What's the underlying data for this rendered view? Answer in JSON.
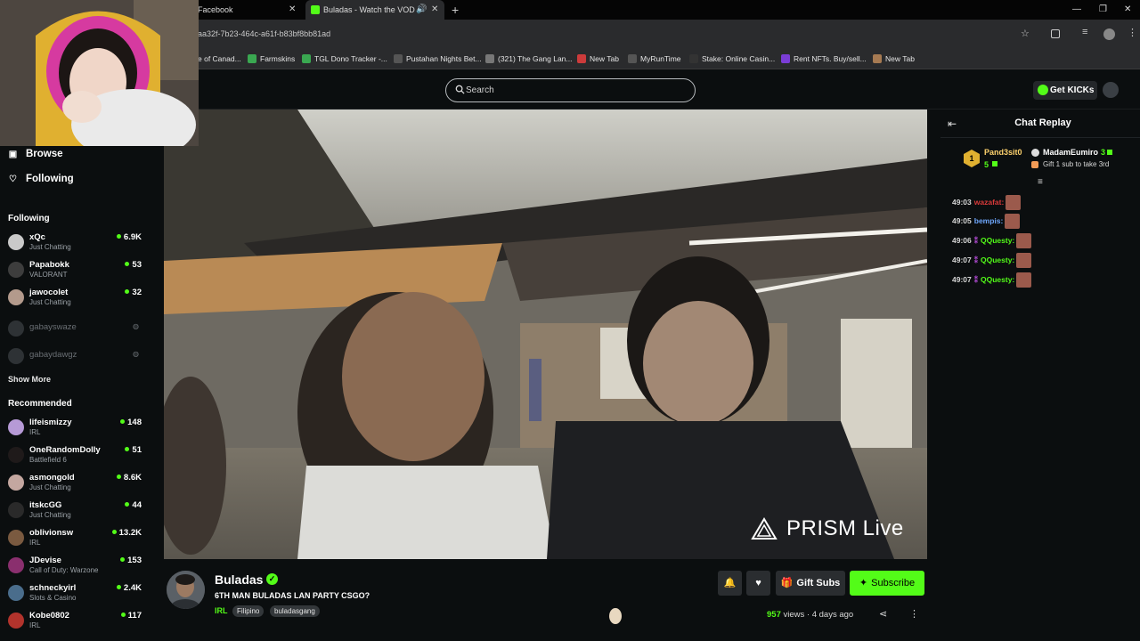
{
  "browser": {
    "tabs": [
      {
        "label": "Facebook",
        "active": false
      },
      {
        "label": "Buladas - Watch the VOD o",
        "active": true
      }
    ],
    "new_tab": "+",
    "url": "aa32f-7b23-464c-a61f-b83bf8bb81ad",
    "bookmarks": [
      "e of Canad...",
      "Farmskins",
      "TGL Dono Tracker -...",
      "Pustahan Nights Bet...",
      "(321) The Gang Lan...",
      "New Tab",
      "MyRunTime",
      "Stake: Online Casin...",
      "Rent NFTs. Buy/sell...",
      "New Tab"
    ]
  },
  "header": {
    "search_placeholder": "Search",
    "get_kicks": "Get KICKs"
  },
  "sidebar": {
    "nav": [
      {
        "label": "Browse",
        "icon": "browse-icon"
      },
      {
        "label": "Following",
        "icon": "heart-icon"
      }
    ],
    "following_title": "Following",
    "following": [
      {
        "name": "xQc",
        "category": "Just Chatting",
        "viewers": "6.9K",
        "avatar_color": "#c9c9c9"
      },
      {
        "name": "Papabokk",
        "category": "VALORANT",
        "viewers": "53",
        "avatar_color": "#3d3d3d"
      },
      {
        "name": "jawocolet",
        "category": "Just Chatting",
        "viewers": "32",
        "avatar_color": "#b39a8c"
      },
      {
        "name": "gabayswaze",
        "category": "",
        "viewers": "",
        "offline": true
      },
      {
        "name": "gabaydawgz",
        "category": "",
        "viewers": "",
        "offline": true
      }
    ],
    "show_more": "Show More",
    "recommended_title": "Recommended",
    "recommended": [
      {
        "name": "lifeismizzy",
        "category": "IRL",
        "viewers": "148",
        "avatar_color": "#b69ad6"
      },
      {
        "name": "OneRandomDolly",
        "category": "Battlefield 6",
        "viewers": "51",
        "avatar_color": "#1f1a1a"
      },
      {
        "name": "asmongold",
        "category": "Just Chatting",
        "viewers": "8.6K",
        "avatar_color": "#c4a7a0"
      },
      {
        "name": "itskcGG",
        "category": "Just Chatting",
        "viewers": "44",
        "avatar_color": "#2a2a2a"
      },
      {
        "name": "oblivionsw",
        "category": "IRL",
        "viewers": "13.2K",
        "avatar_color": "#7a5a40"
      },
      {
        "name": "JDevise",
        "category": "Call of Duty: Warzone",
        "viewers": "153",
        "avatar_color": "#8a2f6e"
      },
      {
        "name": "schneckyirl",
        "category": "Slots & Casino",
        "viewers": "2.4K",
        "avatar_color": "#4a6d8c"
      },
      {
        "name": "Kobe0802",
        "category": "IRL",
        "viewers": "117",
        "avatar_color": "#b2332c"
      }
    ]
  },
  "video": {
    "watermark": "PRISM Live"
  },
  "chat": {
    "title": "Chat Replay",
    "gift": {
      "rank": "1",
      "user1": "Pand3sit0",
      "user1_count": "5",
      "user2": "MadamEumiro",
      "user2_count": "3",
      "caption": "Gift 1 sub to take 3rd"
    },
    "messages": [
      {
        "time": "49:03",
        "user": "wazafat:",
        "color": "#d93a3a"
      },
      {
        "time": "49:05",
        "user": "bempis:",
        "color": "#6fa8ff"
      },
      {
        "time": "49:06",
        "user": "QQuesty:",
        "color": "#53fc18"
      },
      {
        "time": "49:07",
        "user": "QQuesty:",
        "color": "#53fc18"
      },
      {
        "time": "49:07",
        "user": "QQuesty:",
        "color": "#53fc18"
      }
    ]
  },
  "stream": {
    "streamer": "Buladas",
    "title": "6TH MAN BULADAS LAN PARTY CSGO?",
    "category": "IRL",
    "tags": [
      "Filipino",
      "buladasgang"
    ],
    "views_count": "957",
    "views_label": "views",
    "age": "4 days ago",
    "gift_subs": "Gift Subs",
    "subscribe": "Subscribe"
  },
  "colors": {
    "accent": "#53fc18",
    "background": "#0b0e0f"
  }
}
